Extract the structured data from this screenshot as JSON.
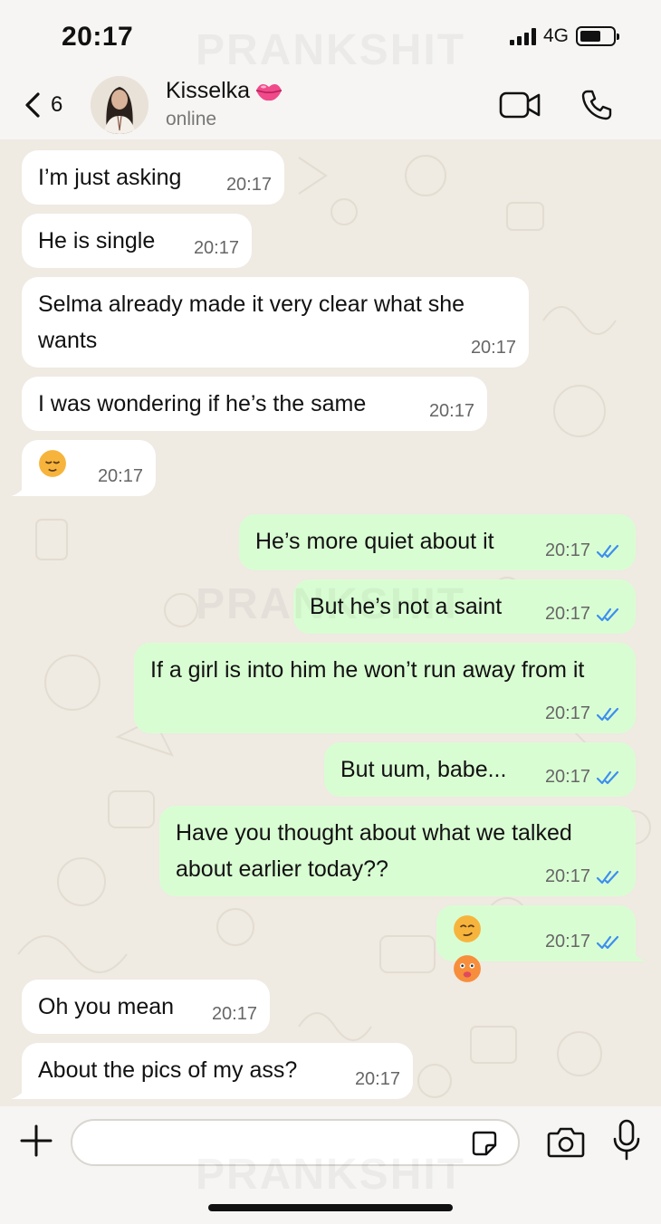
{
  "status_bar": {
    "time": "20:17",
    "network": "4G"
  },
  "header": {
    "back_count": "6",
    "contact_name": "Kisselka",
    "contact_status": "online"
  },
  "watermark": "PRANKSHIT",
  "messages": [
    {
      "dir": "in",
      "text": "I’m just asking",
      "time": "20:17"
    },
    {
      "dir": "in",
      "text": "He is single",
      "time": "20:17"
    },
    {
      "dir": "in",
      "text": "Selma already made it very clear what she wants",
      "time": "20:17"
    },
    {
      "dir": "in",
      "text": "I was wondering if he’s the same",
      "time": "20:17"
    },
    {
      "dir": "in",
      "text": "",
      "emoji": "relieved-face",
      "time": "20:17"
    },
    {
      "dir": "out",
      "text": "He’s more quiet about it",
      "time": "20:17"
    },
    {
      "dir": "out",
      "text": "But he’s not a saint",
      "time": "20:17"
    },
    {
      "dir": "out",
      "text": "If a girl is into him he won’t run away from it",
      "time": "20:17"
    },
    {
      "dir": "out",
      "text": "But uum, babe...",
      "time": "20:17"
    },
    {
      "dir": "out",
      "text": "Have you thought about what we talked about earlier today??",
      "time": "20:17"
    },
    {
      "dir": "out",
      "text": "",
      "emoji": "smirk-and-tongue-faces",
      "time": "20:17"
    },
    {
      "dir": "in",
      "text": "Oh you mean",
      "time": "20:17"
    },
    {
      "dir": "in",
      "text": "About the pics of my ass?",
      "time": "20:17"
    }
  ],
  "colors": {
    "incoming_bubble": "#ffffff",
    "outgoing_bubble": "#d9fdd3",
    "read_ticks": "#3c8ef0",
    "chat_background": "#efeae2"
  },
  "input": {
    "placeholder": ""
  }
}
